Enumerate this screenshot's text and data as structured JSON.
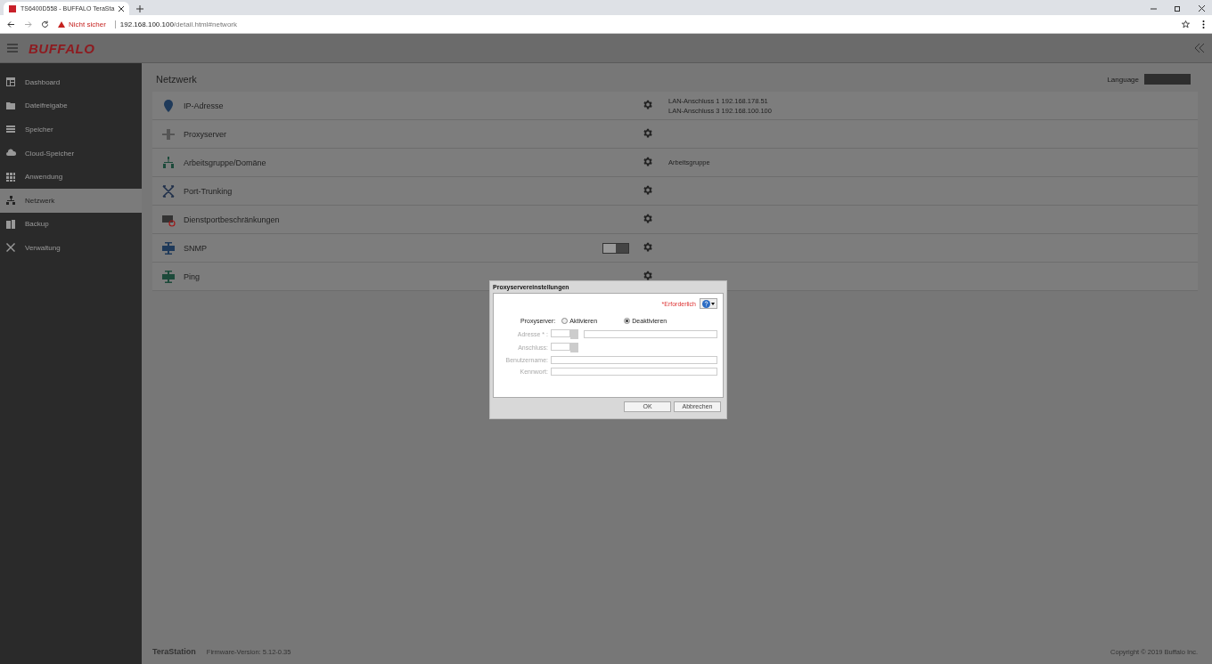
{
  "browser": {
    "tab_title": "TS6400D558 - BUFFALO TeraSta",
    "security": "Nicht sicher",
    "url_host": "192.168.100.100",
    "url_path": "/detail.html#network"
  },
  "app": {
    "logo": "BUFFALO",
    "language_label": "Language"
  },
  "sidebar": {
    "items": [
      {
        "label": "Dashboard",
        "selected": false
      },
      {
        "label": "Dateifreigabe",
        "selected": false
      },
      {
        "label": "Speicher",
        "selected": false
      },
      {
        "label": "Cloud-Speicher",
        "selected": false
      },
      {
        "label": "Anwendung",
        "selected": false
      },
      {
        "label": "Netzwerk",
        "selected": true
      },
      {
        "label": "Backup",
        "selected": false
      },
      {
        "label": "Verwaltung",
        "selected": false
      }
    ]
  },
  "page_title": "Netzwerk",
  "settings": [
    {
      "label": "IP-Adresse",
      "info": [
        "LAN-Anschluss 1 192.168.178.51",
        "LAN-Anschluss 3 192.168.100.100"
      ]
    },
    {
      "label": "Proxyserver"
    },
    {
      "label": "Arbeitsgruppe/Domäne",
      "info": [
        "Arbeitsgruppe"
      ]
    },
    {
      "label": "Port-Trunking"
    },
    {
      "label": "Dienstportbeschränkungen"
    },
    {
      "label": "SNMP",
      "toggle": {
        "on": false
      }
    },
    {
      "label": "Ping"
    }
  ],
  "footer": {
    "product": "TeraStation",
    "firmware": "Firmware-Version: 5.12-0.35",
    "copyright": "Copyright © 2019 Buffalo Inc."
  },
  "dialog": {
    "title": "Proxyservereinstellungen",
    "required": "*Erforderlich",
    "proxy_label": "Proxyserver:",
    "options": [
      {
        "label": "Aktivieren",
        "selected": false
      },
      {
        "label": "Deaktivieren",
        "selected": true
      }
    ],
    "fields": [
      {
        "label": "Adresse * :",
        "kind": "address",
        "disabled": true
      },
      {
        "label": "Anschluss:",
        "kind": "port",
        "disabled": true
      },
      {
        "label": "Benutzername:",
        "kind": "text",
        "disabled": true
      },
      {
        "label": "Kennwort:",
        "kind": "text",
        "disabled": true
      }
    ],
    "buttons": [
      "OK",
      "Abbrechen"
    ]
  }
}
